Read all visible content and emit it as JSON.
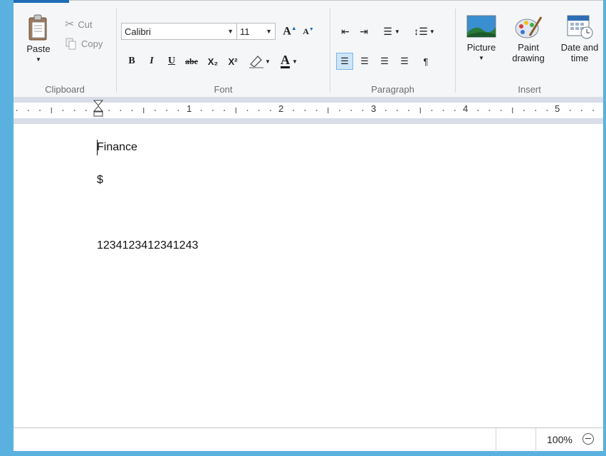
{
  "ribbon": {
    "clipboard": {
      "label": "Clipboard",
      "paste": "Paste",
      "cut": "Cut",
      "copy": "Copy"
    },
    "font": {
      "label": "Font",
      "family": "Calibri",
      "size": "11",
      "bold": "B",
      "italic": "I",
      "underline": "U",
      "strike": "abe",
      "subscript": "X₂",
      "superscript": "X²"
    },
    "paragraph": {
      "label": "Paragraph"
    },
    "insert": {
      "label": "Insert",
      "picture": "Picture",
      "paint_line1": "Paint",
      "paint_line2": "drawing",
      "date_line1": "Date and",
      "date_line2": "time"
    }
  },
  "ruler": {
    "marks": [
      "1",
      "2",
      "3",
      "4",
      "5"
    ]
  },
  "document": {
    "lines": [
      "Finance",
      "$",
      "1234123412341243"
    ]
  },
  "status": {
    "zoom": "100%"
  },
  "colors": {
    "frame": "#5ab1df",
    "accent": "#1e6cb8",
    "selection": "#cde6f7"
  }
}
